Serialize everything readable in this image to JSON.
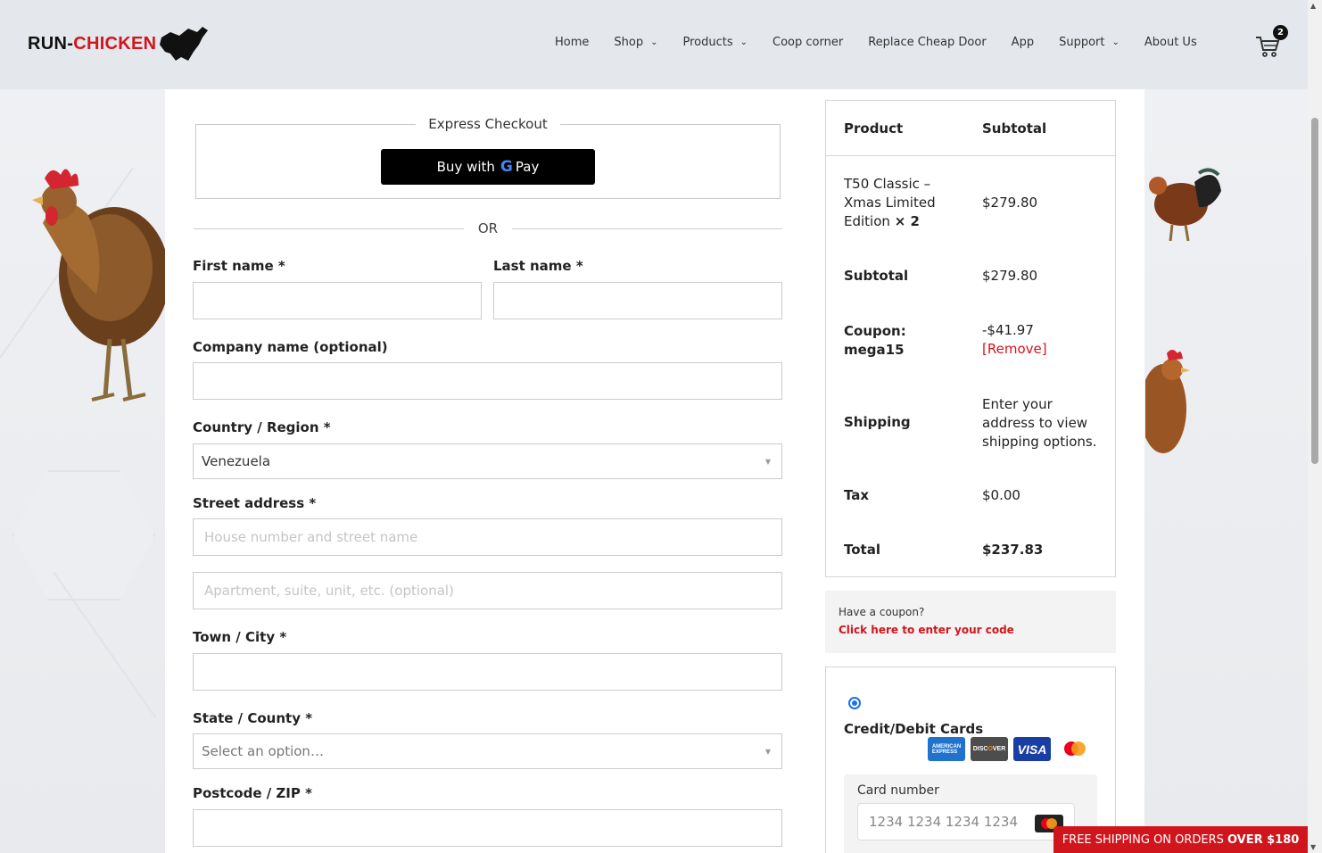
{
  "brand": {
    "part1": "RUN-",
    "part2": "CHICKEN"
  },
  "nav": {
    "items": [
      {
        "label": "Home",
        "dropdown": false
      },
      {
        "label": "Shop",
        "dropdown": true
      },
      {
        "label": "Products",
        "dropdown": true
      },
      {
        "label": "Coop corner",
        "dropdown": false
      },
      {
        "label": "Replace Cheap Door",
        "dropdown": false
      },
      {
        "label": "App",
        "dropdown": false
      },
      {
        "label": "Support",
        "dropdown": true
      },
      {
        "label": "About Us",
        "dropdown": false
      }
    ],
    "cart_count": "2"
  },
  "express": {
    "legend": "Express Checkout",
    "gpay_label": "Buy with",
    "gpay_brand": "Pay"
  },
  "or_label": "OR",
  "form": {
    "first_name_label": "First name *",
    "last_name_label": "Last name *",
    "company_label": "Company name (optional)",
    "country_label": "Country / Region *",
    "country_value": "Venezuela",
    "street_label": "Street address *",
    "street_placeholder": "House number and street name",
    "street2_placeholder": "Apartment, suite, unit, etc. (optional)",
    "city_label": "Town / City *",
    "state_label": "State / County *",
    "state_value": "Select an option…",
    "zip_label": "Postcode / ZIP *"
  },
  "summary": {
    "col_product": "Product",
    "col_subtotal": "Subtotal",
    "item_name": "T50 Classic – Xmas Limited Edition",
    "item_qty": "× 2",
    "item_price": "$279.80",
    "subtotal_label": "Subtotal",
    "subtotal_value": "$279.80",
    "coupon_label": "Coupon: mega15",
    "coupon_value": "-$41.97",
    "coupon_remove": "[Remove]",
    "shipping_label": "Shipping",
    "shipping_value": "Enter your address to view shipping options.",
    "tax_label": "Tax",
    "tax_value": "$0.00",
    "total_label": "Total",
    "total_value": "$237.83"
  },
  "coupon_prompt": {
    "question": "Have a coupon?",
    "link": "Click here to enter your code"
  },
  "payment": {
    "method": "Credit/Debit Cards",
    "cards": [
      "amex",
      "discover",
      "visa",
      "mastercard"
    ],
    "card_number_label": "Card number",
    "card_number_placeholder": "1234 1234 1234 1234"
  },
  "promo": {
    "text": "FREE SHIPPING ON ORDERS",
    "bold": "OVER $180"
  },
  "colors": {
    "accent": "#d1151c",
    "gpay_bg": "#000000",
    "radio": "#1a73e8"
  }
}
